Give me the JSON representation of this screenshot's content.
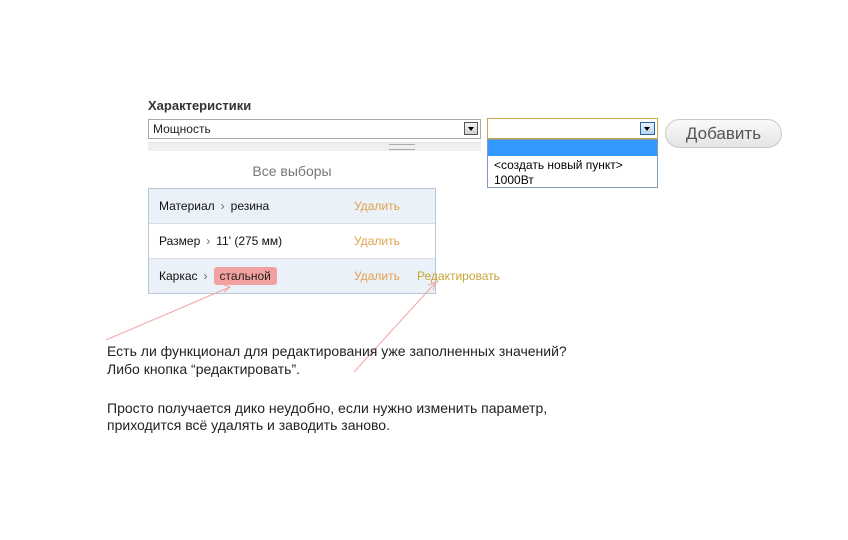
{
  "form": {
    "section_title": "Характеристики",
    "characteristic_select": {
      "selected": "Мощность"
    },
    "value_select": {
      "selected": "",
      "options": [
        "<создать новый пункт>",
        "1000Вт"
      ]
    },
    "add_button_label": "Добавить"
  },
  "choices": {
    "heading": "Все выборы",
    "separator": "›",
    "rows": [
      {
        "name": "Материал",
        "value": "резина",
        "delete_label": "Удалить"
      },
      {
        "name": "Размер",
        "value": "11' (275 мм)",
        "delete_label": "Удалить"
      },
      {
        "name": "Каркас",
        "value": "стальной",
        "delete_label": "Удалить",
        "edit_label": "Редактировать"
      }
    ]
  },
  "comment": {
    "question_line1": "Есть ли функционал для редактирования уже заполненных значений?",
    "question_line2": "Либо кнопка “редактировать”.",
    "paragraph_line1": "Просто получается дико неудобно, если нужно изменить параметр,",
    "paragraph_line2": "приходится всё удалять и заводить заново."
  },
  "colors": {
    "delete_link": "#e2a24e",
    "edit_link": "#c9a435",
    "highlight_chip": "#f3a0a0",
    "selected_option": "#3399ff",
    "annotation_arrow": "#f2a5a5"
  }
}
